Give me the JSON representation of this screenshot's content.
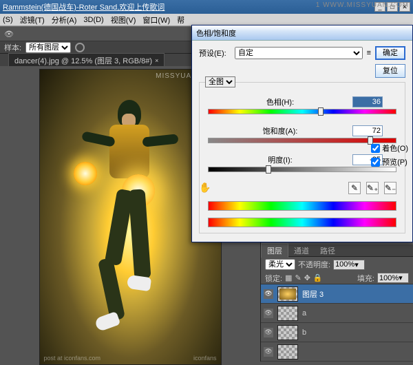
{
  "title": "Rammstein(德国战车)-Roter Sand,欢迎上传歌词",
  "watermark_top": "1 WWW.MISSYUAN.COM",
  "menu": {
    "select": "(S)",
    "filter": "滤镜(T)",
    "analysis": "分析(A)",
    "threed": "3D(D)",
    "view": "视图(V)",
    "window": "窗口(W)",
    "help": "帮"
  },
  "toolbar": {
    "sample_label": "样本:",
    "sample_value": "所有图层"
  },
  "tab": {
    "name": "dancer(4).jpg @ 12.5% (图层 3, RGB/8#)",
    "close": "×"
  },
  "image": {
    "watermark": "MISSYUAN.COM",
    "credit": "post at iconfans.com",
    "credit2": "iconfans"
  },
  "panel": {
    "tabs": {
      "layers": "图层",
      "channels": "通道",
      "paths": "路径"
    },
    "blend_mode": "柔光",
    "opacity_label": "不透明度:",
    "opacity": "100%",
    "lock_label": "锁定:",
    "fill_label": "填充:",
    "fill": "100%",
    "layers": [
      {
        "name": "图层 3"
      },
      {
        "name": "a"
      },
      {
        "name": "b"
      }
    ]
  },
  "dialog": {
    "title": "色相/饱和度",
    "preset_label": "预设(E):",
    "preset_value": "自定",
    "ok": "确定",
    "reset": "复位",
    "channel": "全图",
    "hue_label": "色相(H):",
    "hue_value": "36",
    "sat_label": "饱和度(A):",
    "sat_value": "72",
    "light_label": "明度(I):",
    "light_value": "-35",
    "colorize": "着色(O)",
    "preview": "预览(P)",
    "hand": "✋"
  }
}
